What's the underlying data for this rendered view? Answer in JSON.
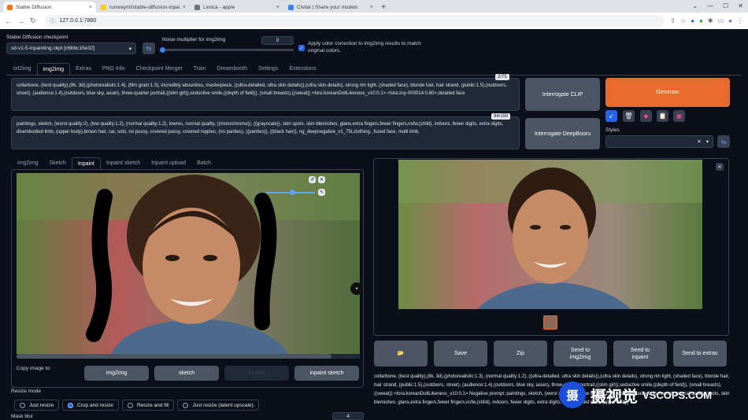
{
  "browser": {
    "tabs": [
      {
        "title": "Stable Diffusion",
        "fav_color": "#f97316"
      },
      {
        "title": "runwayml/stable-diffusion-inpai...",
        "fav_color": "#facc15"
      },
      {
        "title": "Lexica - apple",
        "fav_color": "#6b7280"
      },
      {
        "title": "Civitai | Share your models",
        "fav_color": "#3b82f6"
      }
    ],
    "url": "127.0.0.1:7860"
  },
  "header": {
    "checkpoint_label": "Stable Diffusion checkpoint",
    "checkpoint_value": "sd-v1-5-inpainting.ckpt [c6bbc15e32]",
    "noise_label": "Noise multiplier for img2img",
    "noise_value": "0",
    "noise_fraction": 0,
    "color_correction_label": "Apply color correction to img2img results to match original colors."
  },
  "main_tabs": [
    "txt2img",
    "img2img",
    "Extras",
    "PNG Info",
    "Checkpoint Merger",
    "Train",
    "Dreambooth",
    "Settings",
    "Extensions"
  ],
  "main_tab_active": 1,
  "prompt": {
    "counter": "2/75",
    "text": "collarbone, (best quality),(8k, 3d),(photorealistic:1.4), (film grain:1.3), incredibly absurdres, masterpiece, ((ultra-detailed, ultra skin details)),(ultra skin details), strong rim light, (shaded face), blonde hair, hair strand, (public:1.5),(outdoors, street), (audience:1.4),(outdoors, blue sky, asian), three-quarter portrait,((slim girl)),seductive smile,((depth of field)), (small breasts),((sweat)) <lora:koreanDollLikeness_v10:0.1> <lora:zsy-000014:0.80>,detailed face"
  },
  "negative_prompt": {
    "counter": "94/150",
    "text": "paintings, sketch, (worst quality:2), (low quality:1.2), (normal quality:1.2), lowres, normal quality, ((monochrome)), ((grayscale)), skin spots, skin blemishes, glans,extra fingers,fewer fingers,nsfw,(child), indoors, fewer digits, extra digits, disembodied limb, (upper body),brown hair, car, solo, no pussy, covered pussy, covered nipples, (no panties), ((panties)), ((black hair)), ng_deepnegative_v1_75t,clothing, ,fused face, multi limb,"
  },
  "buttons": {
    "interrogate_clip": "Interrogate CLIP",
    "interrogate_deepbooru": "Interrogate DeepBooru",
    "generate": "Generate"
  },
  "styles_label": "Styles",
  "sub_tabs": [
    "img2img",
    "Sketch",
    "Inpaint",
    "Inpaint sketch",
    "Inpaint upload",
    "Batch"
  ],
  "sub_tab_active": 2,
  "copy_label": "Copy image to:",
  "copy_buttons": [
    "img2img",
    "sketch",
    "inpaint",
    "inpaint sketch"
  ],
  "resize_label": "Resize mode",
  "resize_options": [
    "Just resize",
    "Crop and resize",
    "Resize and fill",
    "Just resize (latent upscale)"
  ],
  "resize_selected": 1,
  "mask_blur_label": "Mask blur",
  "mask_blur_value": "4",
  "output_buttons": [
    "📂",
    "Save",
    "Zip",
    "Send to img2img",
    "Send to inpaint",
    "Send to extras"
  ],
  "output_info": "collarbone, (best quality),(8k, 3d),(photorealistic:1.3), (normal quality:1.2), ((ultra-detailed, ultra skin details)),(ultra skin details), strong rim light, (shaded face), blonde hair, hair strand, (public:1.5),(outdoors, street), (audience:1.4),(outdoors, blue sky, asian), three-quarter portrait,((slim girl)),seductive smile,((depth of field)), (small breasts),((sweat)) <lora:koreanDollLikeness_v10:0.1> Negative prompt: paintings, sketch, (worst quality:2), (low quality:1.2), (normal quality:1.2), lowres, normal quality, spots, skin blemishes, glans,extra fingers,fewer fingers,nsfw,(child), indoors, fewer digits, extra digits, disembodied limb, (upper body)",
  "watermark": {
    "cn": "摄视觉",
    "en": "VSCOPS.COM"
  }
}
